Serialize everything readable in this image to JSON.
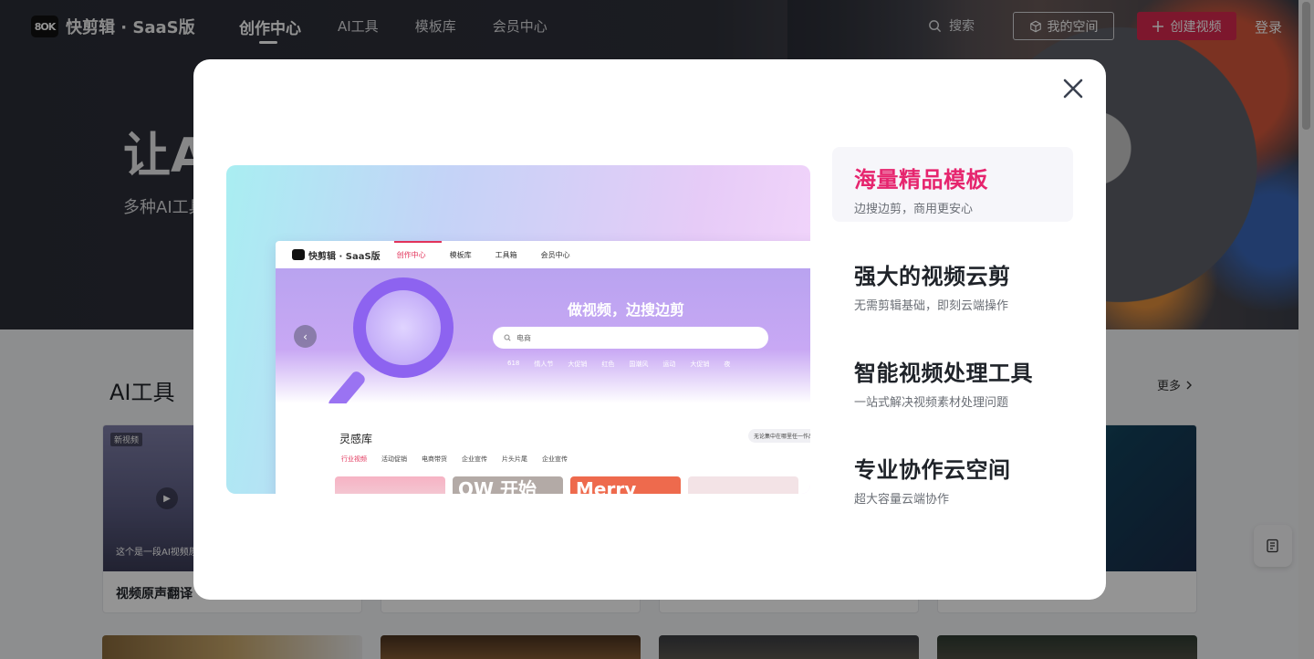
{
  "header": {
    "logo_mark": "8OK",
    "logo_text": "快剪辑 · SaaS版",
    "nav": [
      {
        "label": "创作中心"
      },
      {
        "label": "AI工具"
      },
      {
        "label": "模板库"
      },
      {
        "label": "会员中心"
      }
    ],
    "search_label": "搜索",
    "space_label": "我的空间",
    "create_label": "创建视频",
    "login_label": "登录"
  },
  "hero": {
    "title": "让A",
    "subtitle": "多种AI工具"
  },
  "ai_tools": {
    "title": "AI工具",
    "more_label": "更多",
    "cards": [
      {
        "title": "视频原声翻译",
        "badge": "新视频",
        "caption": "这个是一段AI视频原"
      }
    ]
  },
  "modal": {
    "preview": {
      "logo_text": "快剪辑 · SaaS版",
      "tabs": [
        "创作中心",
        "模板库",
        "工具箱",
        "会员中心"
      ],
      "headline": "做视频，边搜边剪",
      "search_placeholder": "电商",
      "hot_tags": [
        "618",
        "情人节",
        "大促销",
        "红色",
        "国潮风",
        "运动",
        "大促销",
        "夜"
      ],
      "library_title": "灵感库",
      "library_tabs": [
        "行业视频",
        "活动促销",
        "电商带货",
        "企业宣传",
        "片头片尾",
        "企业宣传"
      ],
      "pill_text": "无论集中在哪里任一作品",
      "thumbs": [
        "",
        "OW 开始",
        "Merry",
        ""
      ]
    },
    "features": [
      {
        "title": "海量精品模板",
        "desc": "边搜边剪，商用更安心"
      },
      {
        "title": "强大的视频云剪",
        "desc": "无需剪辑基础，即刻云端操作"
      },
      {
        "title": "智能视频处理工具",
        "desc": "一站式解决视频素材处理问题"
      },
      {
        "title": "专业协作云空间",
        "desc": "超大容量云端协作"
      }
    ]
  },
  "colors": {
    "accent": "#d7294f",
    "feature_active": "#e6256e"
  }
}
